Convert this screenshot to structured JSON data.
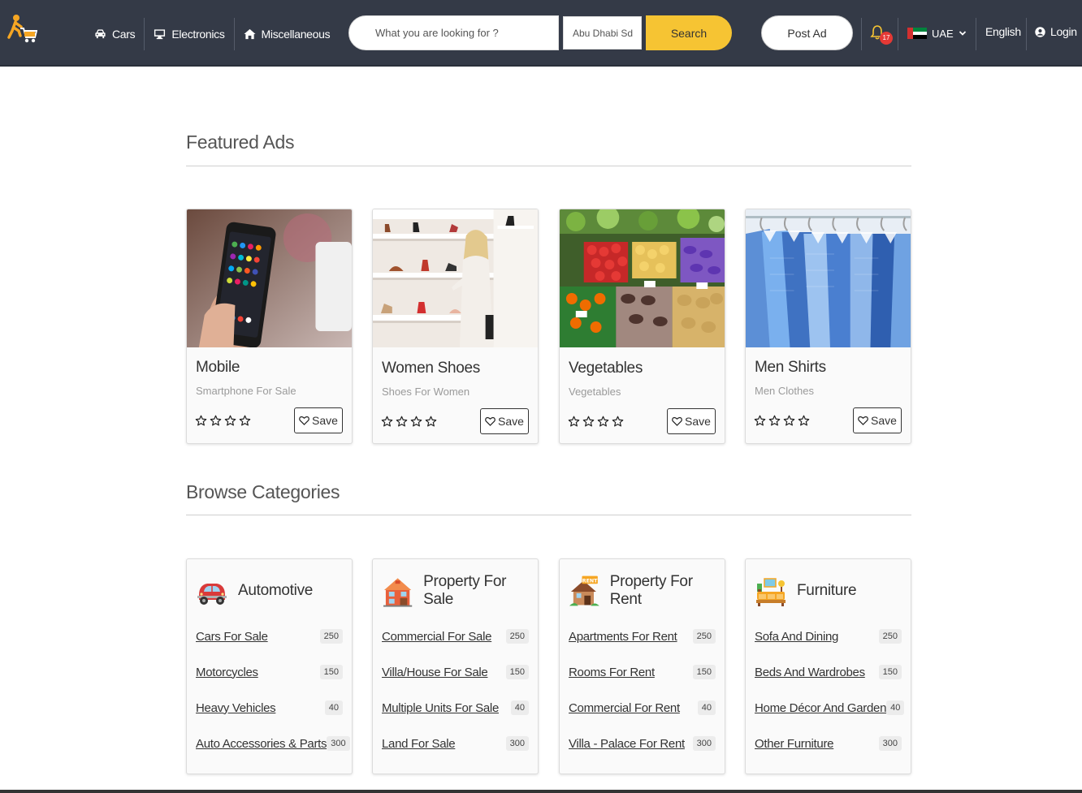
{
  "header": {
    "nav": [
      {
        "label": "Cars",
        "icon": "car-icon"
      },
      {
        "label": "Electronics",
        "icon": "monitor-icon"
      },
      {
        "label": "Miscellaneous",
        "icon": "home-icon"
      }
    ],
    "search_placeholder": "What you are looking for ?",
    "location_value": "Abu Dhabi Sd",
    "search_label": "Search",
    "post_ad_label": "Post Ad",
    "notifications_count": "17",
    "country": "UAE",
    "language": "English",
    "login_label": "Login",
    "colors": {
      "bar": "#343a47",
      "accent": "#f6c433",
      "badge": "#e53935"
    }
  },
  "featured": {
    "title": "Featured Ads",
    "save_label": "Save",
    "rating_stars": 4,
    "ads": [
      {
        "title": "Mobile",
        "subtitle": "Smartphone For Sale",
        "image": "smartphone-photo"
      },
      {
        "title": "Women Shoes",
        "subtitle": "Shoes For Women",
        "image": "shoe-store-photo"
      },
      {
        "title": "Vegetables",
        "subtitle": "Vegetables",
        "image": "vegetable-market-photo"
      },
      {
        "title": "Men Shirts",
        "subtitle": "Men Clothes",
        "image": "shirts-rack-photo"
      }
    ]
  },
  "categories": {
    "title": "Browse Categories",
    "items": [
      {
        "title": "Automotive",
        "icon": "car-icon",
        "links": [
          {
            "label": "Cars For Sale",
            "count": "250"
          },
          {
            "label": "Motorcycles",
            "count": "150"
          },
          {
            "label": "Heavy Vehicles",
            "count": "40"
          },
          {
            "label": "Auto Accessories & Parts",
            "count": "300"
          }
        ]
      },
      {
        "title": "Property For Sale",
        "icon": "house-icon",
        "links": [
          {
            "label": "Commercial For Sale",
            "count": "250"
          },
          {
            "label": "Villa/House For Sale",
            "count": "150"
          },
          {
            "label": "Multiple Units For Sale",
            "count": "40"
          },
          {
            "label": "Land For Sale",
            "count": "300"
          }
        ]
      },
      {
        "title": "Property For Rent",
        "icon": "rent-house-icon",
        "icon_text": "RENT",
        "links": [
          {
            "label": "Apartments For Rent",
            "count": "250"
          },
          {
            "label": "Rooms For Rent",
            "count": "150"
          },
          {
            "label": "Commercial For Rent",
            "count": "40"
          },
          {
            "label": "Villa - Palace For Rent",
            "count": "300"
          }
        ]
      },
      {
        "title": "Furniture",
        "icon": "furniture-icon",
        "links": [
          {
            "label": "Sofa And Dining",
            "count": "250"
          },
          {
            "label": "Beds And Wardrobes",
            "count": "150"
          },
          {
            "label": "Home Décor And Garden",
            "count": "40"
          },
          {
            "label": "Other Furniture",
            "count": "300"
          }
        ]
      }
    ]
  }
}
